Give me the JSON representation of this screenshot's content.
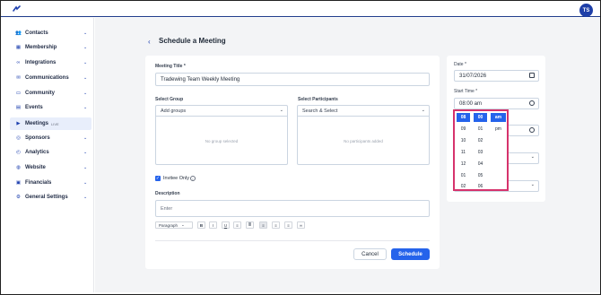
{
  "app": {
    "user_initials": "TS"
  },
  "sidebar": {
    "items": [
      {
        "label": "Contacts",
        "icon": "contacts-icon"
      },
      {
        "label": "Membership",
        "icon": "membership-icon"
      },
      {
        "label": "Integrations",
        "icon": "link-icon"
      },
      {
        "label": "Communications",
        "icon": "mail-icon"
      },
      {
        "label": "Community",
        "icon": "chat-icon"
      },
      {
        "label": "Events",
        "icon": "calendar-icon"
      },
      {
        "label": "Meetings",
        "icon": "video-icon",
        "badge": "LIVE"
      },
      {
        "label": "Sponsors",
        "icon": "sponsor-icon"
      },
      {
        "label": "Analytics",
        "icon": "analytics-icon"
      },
      {
        "label": "Website",
        "icon": "globe-icon"
      },
      {
        "label": "Financials",
        "icon": "wallet-icon"
      },
      {
        "label": "General Settings",
        "icon": "gear-icon"
      }
    ]
  },
  "page": {
    "back_glyph": "‹",
    "title": "Schedule a Meeting",
    "meeting_title_label": "Meeting Title *",
    "meeting_title_value": "Tradewing Team Weekly Meeting",
    "select_group_label": "Select Group",
    "select_group_placeholder": "Add groups",
    "no_group": "No group selected",
    "select_participants_label": "Select Participants",
    "select_participants_placeholder": "Search & Select",
    "no_participants": "No participants added",
    "invitee_only_label": "Invitee Only",
    "invitee_only_checked": true,
    "description_label": "Description",
    "description_placeholder": "Enter",
    "toolbar": {
      "paragraph": "Paragraph",
      "bold": "B",
      "italic": "I",
      "underline": "U"
    },
    "cancel_label": "Cancel",
    "schedule_label": "Schedule"
  },
  "side_panel": {
    "date_label": "Date *",
    "date_value": "31/07/2026",
    "start_time_label": "Start Time *",
    "start_time_value": "08:00 am"
  },
  "time_picker": {
    "hours": [
      "08",
      "09",
      "10",
      "11",
      "12",
      "01",
      "02"
    ],
    "minutes": [
      "00",
      "01",
      "02",
      "03",
      "04",
      "05",
      "06"
    ],
    "periods": [
      "am",
      "pm"
    ],
    "selected": {
      "hour": "08",
      "minute": "00",
      "period": "am"
    }
  },
  "colors": {
    "accent": "#2563eb",
    "highlight_border": "#d6336c",
    "topbar_border": "#1e3a8a"
  }
}
